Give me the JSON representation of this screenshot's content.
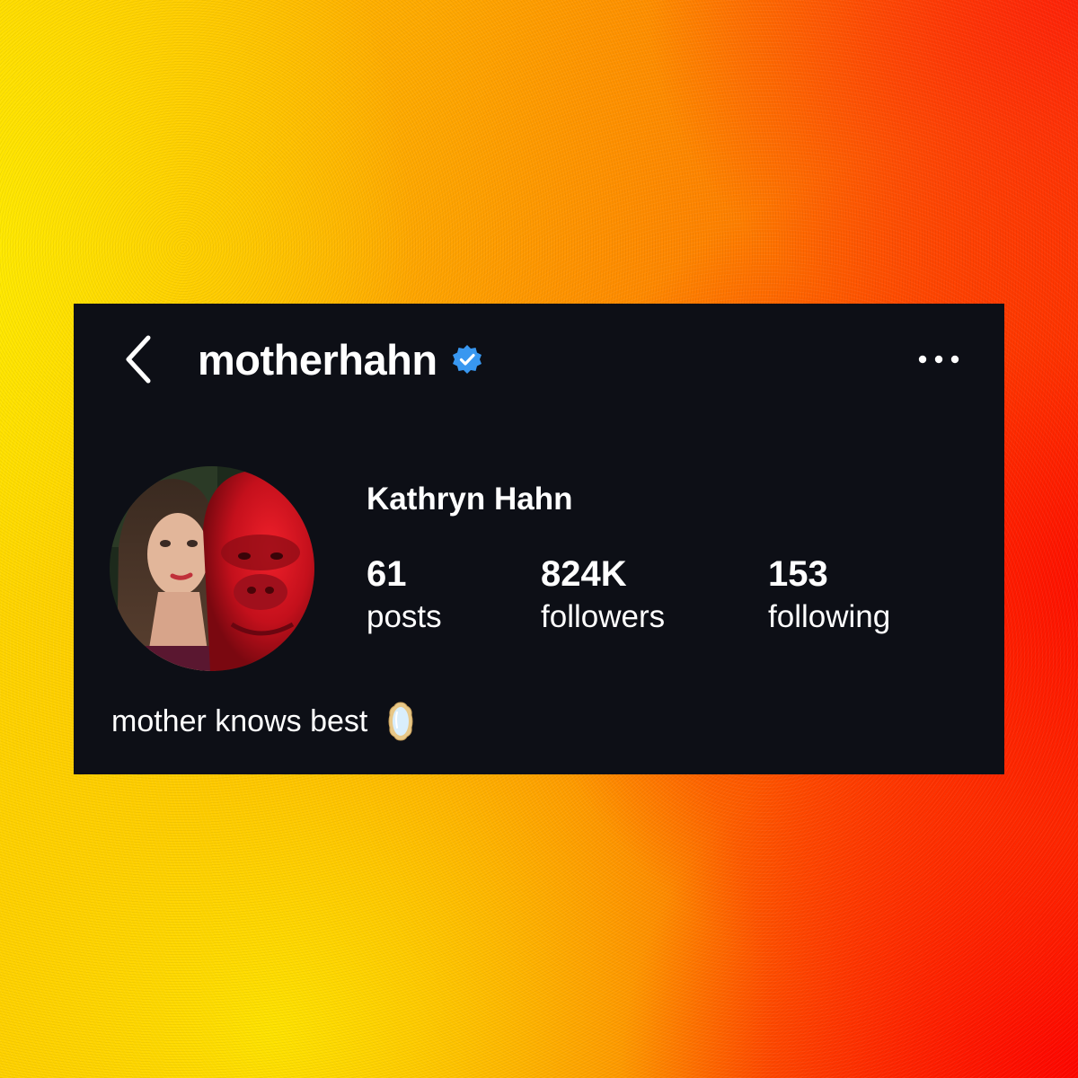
{
  "background": {
    "colors": [
      "#ffe600",
      "#ff9a00",
      "#ff2a00"
    ]
  },
  "header": {
    "back_icon": "chevron-left-icon",
    "username": "motherhahn",
    "verified_icon": "verified-badge-icon",
    "verified_color": "#3897f0",
    "more_icon": "more-horizontal-icon"
  },
  "profile": {
    "display_name": "Kathryn Hahn",
    "avatar": "profile-photo",
    "stats": {
      "posts": {
        "value": "61",
        "label": "posts"
      },
      "followers": {
        "value": "824K",
        "label": "followers"
      },
      "following": {
        "value": "153",
        "label": "following"
      }
    },
    "bio": {
      "text": "mother knows best",
      "emoji": "mirror-emoji"
    }
  },
  "colors": {
    "card_background": "#0d0f16",
    "text": "#ffffff"
  }
}
